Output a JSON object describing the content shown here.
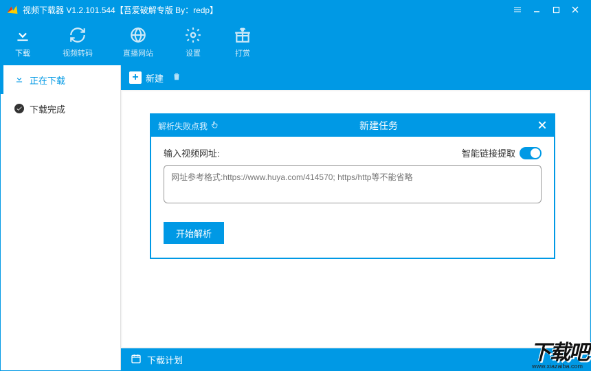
{
  "title": "视频下载器 V1.2.101.544【吾爱破解专版  By：redp】",
  "toolbar": {
    "download": "下载",
    "transcode": "视频转码",
    "liveSite": "直播网站",
    "settings": "设置",
    "donate": "打赏"
  },
  "sidebar": {
    "downloading": "正在下载",
    "completed": "下载完成"
  },
  "mainbar": {
    "newTask": "新建"
  },
  "modal": {
    "hint": "解析失败点我",
    "title": "新建任务",
    "urlLabel": "输入视频网址:",
    "smartExtract": "智能链接提取",
    "placeholder": "网址参考格式:https://www.huya.com/414570; https/http等不能省略",
    "parse": "开始解析"
  },
  "footer": {
    "schedule": "下载计划"
  },
  "watermark": {
    "main": "下载吧",
    "sub": "www.xiazaiba.com"
  }
}
